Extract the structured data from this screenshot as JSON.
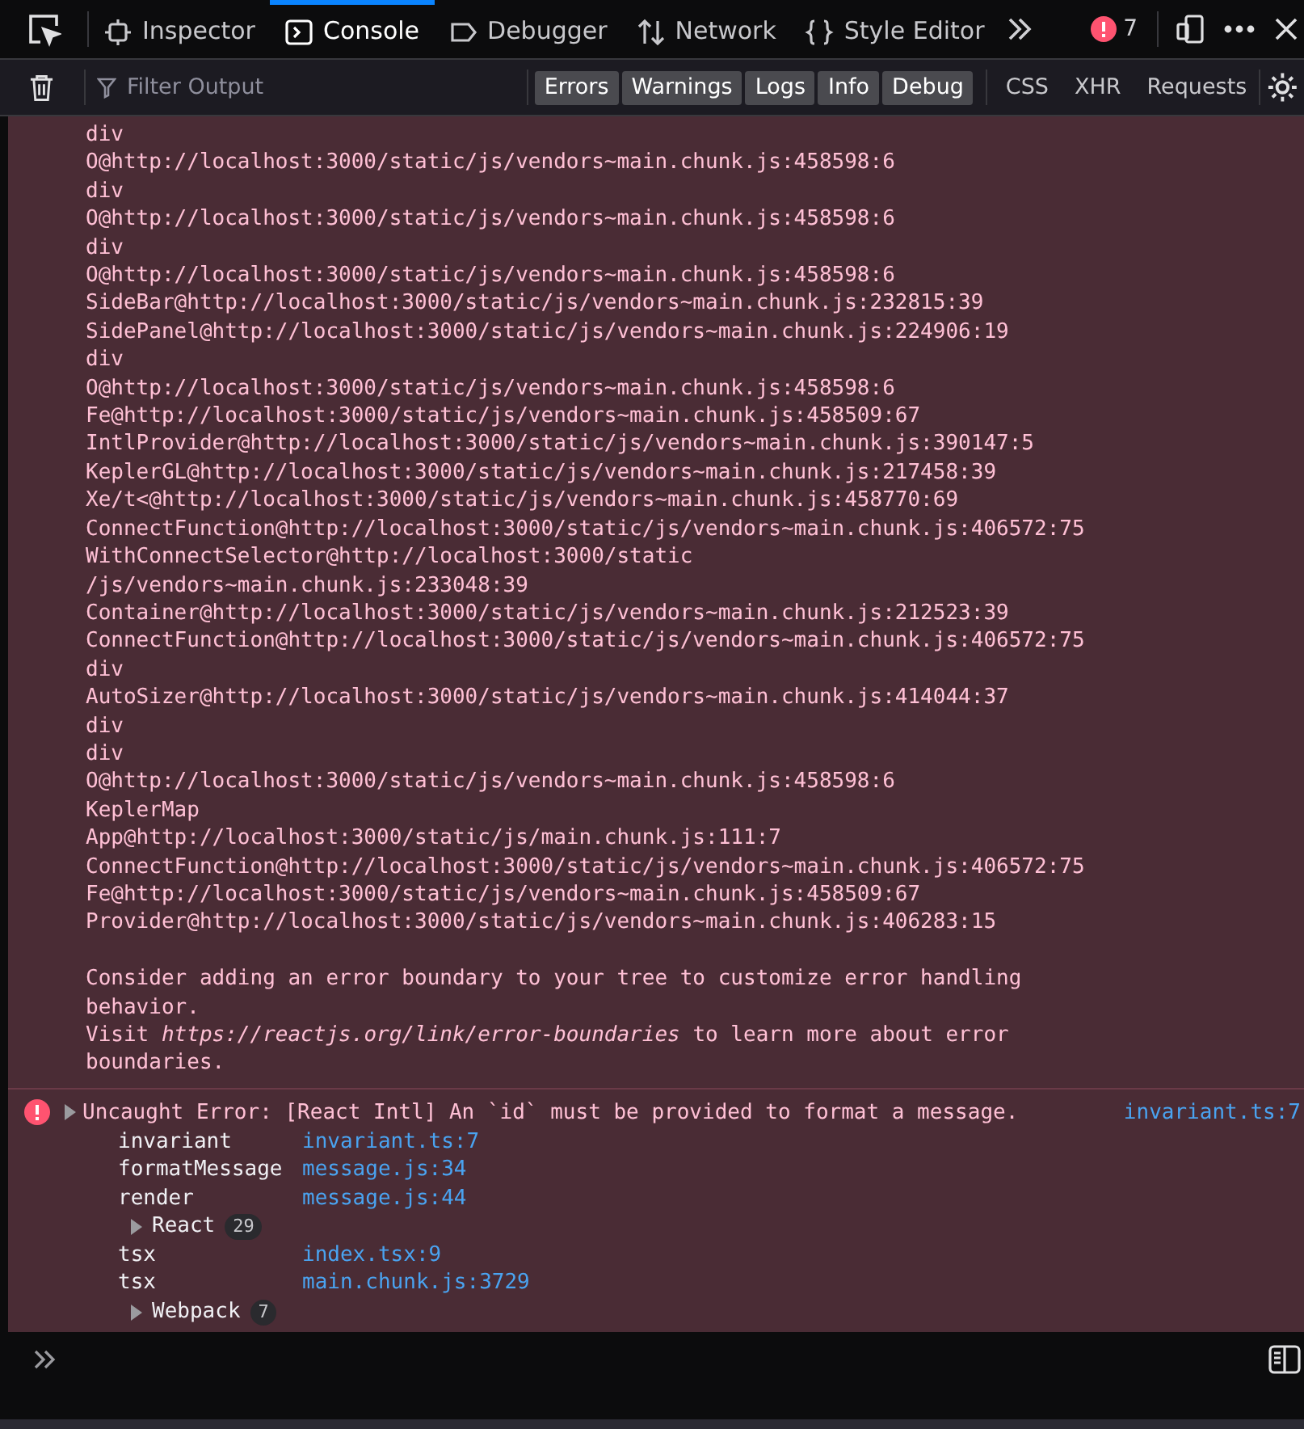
{
  "tabs": [
    {
      "label": "Inspector",
      "kind": "inspector",
      "selected": false
    },
    {
      "label": "Console",
      "kind": "console",
      "selected": true
    },
    {
      "label": "Debugger",
      "kind": "debugger",
      "selected": false
    },
    {
      "label": "Network",
      "kind": "network",
      "selected": false
    },
    {
      "label": "Style Editor",
      "kind": "style",
      "selected": false
    }
  ],
  "error_count": "7",
  "filter": {
    "placeholder": "Filter Output"
  },
  "level_filters": [
    {
      "label": "Errors",
      "selected": true
    },
    {
      "label": "Warnings",
      "selected": true
    },
    {
      "label": "Logs",
      "selected": true
    },
    {
      "label": "Info",
      "selected": true
    },
    {
      "label": "Debug",
      "selected": true
    }
  ],
  "type_filters": [
    {
      "label": "CSS",
      "selected": false
    },
    {
      "label": "XHR",
      "selected": false
    },
    {
      "label": "Requests",
      "selected": false
    }
  ],
  "log_lines": [
    "div",
    "O@http://localhost:3000/static/js/vendors~main.chunk.js:458598:6",
    "div",
    "O@http://localhost:3000/static/js/vendors~main.chunk.js:458598:6",
    "div",
    "O@http://localhost:3000/static/js/vendors~main.chunk.js:458598:6",
    "SideBar@http://localhost:3000/static/js/vendors~main.chunk.js:232815:39",
    "SidePanel@http://localhost:3000/static/js/vendors~main.chunk.js:224906:19",
    "div",
    "O@http://localhost:3000/static/js/vendors~main.chunk.js:458598:6",
    "Fe@http://localhost:3000/static/js/vendors~main.chunk.js:458509:67",
    "IntlProvider@http://localhost:3000/static/js/vendors~main.chunk.js:390147:5",
    "KeplerGL@http://localhost:3000/static/js/vendors~main.chunk.js:217458:39",
    "Xe/t<@http://localhost:3000/static/js/vendors~main.chunk.js:458770:69",
    "ConnectFunction@http://localhost:3000/static/js/vendors~main.chunk.js:406572:75",
    "WithConnectSelector@http://localhost:3000/static",
    "/js/vendors~main.chunk.js:233048:39",
    "Container@http://localhost:3000/static/js/vendors~main.chunk.js:212523:39",
    "ConnectFunction@http://localhost:3000/static/js/vendors~main.chunk.js:406572:75",
    "div",
    "AutoSizer@http://localhost:3000/static/js/vendors~main.chunk.js:414044:37",
    "div",
    "div",
    "O@http://localhost:3000/static/js/vendors~main.chunk.js:458598:6",
    "KeplerMap",
    "App@http://localhost:3000/static/js/main.chunk.js:111:7",
    "ConnectFunction@http://localhost:3000/static/js/vendors~main.chunk.js:406572:75",
    "Fe@http://localhost:3000/static/js/vendors~main.chunk.js:458509:67",
    "Provider@http://localhost:3000/static/js/vendors~main.chunk.js:406283:15"
  ],
  "paragraphs": [
    "Consider adding an error boundary to your tree to customize error handling behavior.",
    "Visit *https://reactjs.org/link/error-boundaries* to learn more about error boundaries."
  ],
  "error": {
    "message": "Uncaught Error: [React Intl] An `id` must be provided to format a message.",
    "location": "invariant.ts:7",
    "expanded": false,
    "frames": [
      {
        "kind": "frame",
        "name": "invariant",
        "location": "invariant.ts:7"
      },
      {
        "kind": "frame",
        "name": "formatMessage",
        "location": "message.js:34"
      },
      {
        "kind": "frame",
        "name": "render",
        "location": "message.js:44"
      },
      {
        "kind": "group",
        "name": "React",
        "count": "29"
      },
      {
        "kind": "frame",
        "name": "tsx",
        "location": "index.tsx:9"
      },
      {
        "kind": "frame",
        "name": "tsx",
        "location": "main.chunk.js:3729"
      },
      {
        "kind": "group",
        "name": "Webpack",
        "count": "7"
      }
    ]
  }
}
